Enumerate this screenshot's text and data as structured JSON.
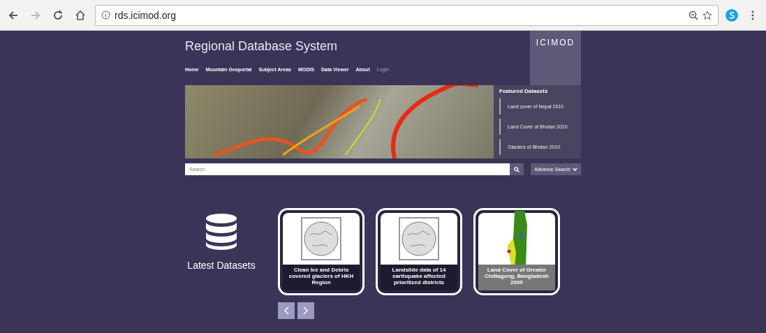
{
  "browser": {
    "url": "rds.icimod.org"
  },
  "header": {
    "title": "Regional Database System",
    "logo": "ICIMOD",
    "nav": [
      "Home",
      "Mountain Geoportal",
      "Subject Areas",
      "MODIS",
      "Data Viewer",
      "About",
      "Login"
    ]
  },
  "featured": {
    "title": "Featured Datasets",
    "items": [
      "Land cover of Nepal 2010",
      "Land Cover of Bhutan 2010",
      "Glaciers of Bhutan 2010"
    ]
  },
  "search": {
    "placeholder": "Search",
    "advanced": "Advance Search"
  },
  "latest": {
    "title": "Latest Datasets",
    "cards": [
      {
        "kind": "map",
        "caption": "Clean Ice and Debris covered glaciers of HKH Region"
      },
      {
        "kind": "map",
        "caption": "Landslide data of 14 earthquake affected prioritized districts"
      },
      {
        "kind": "landcover",
        "caption": "Land Cover of Greater Chittagong, Bangladesh 2000"
      }
    ]
  }
}
